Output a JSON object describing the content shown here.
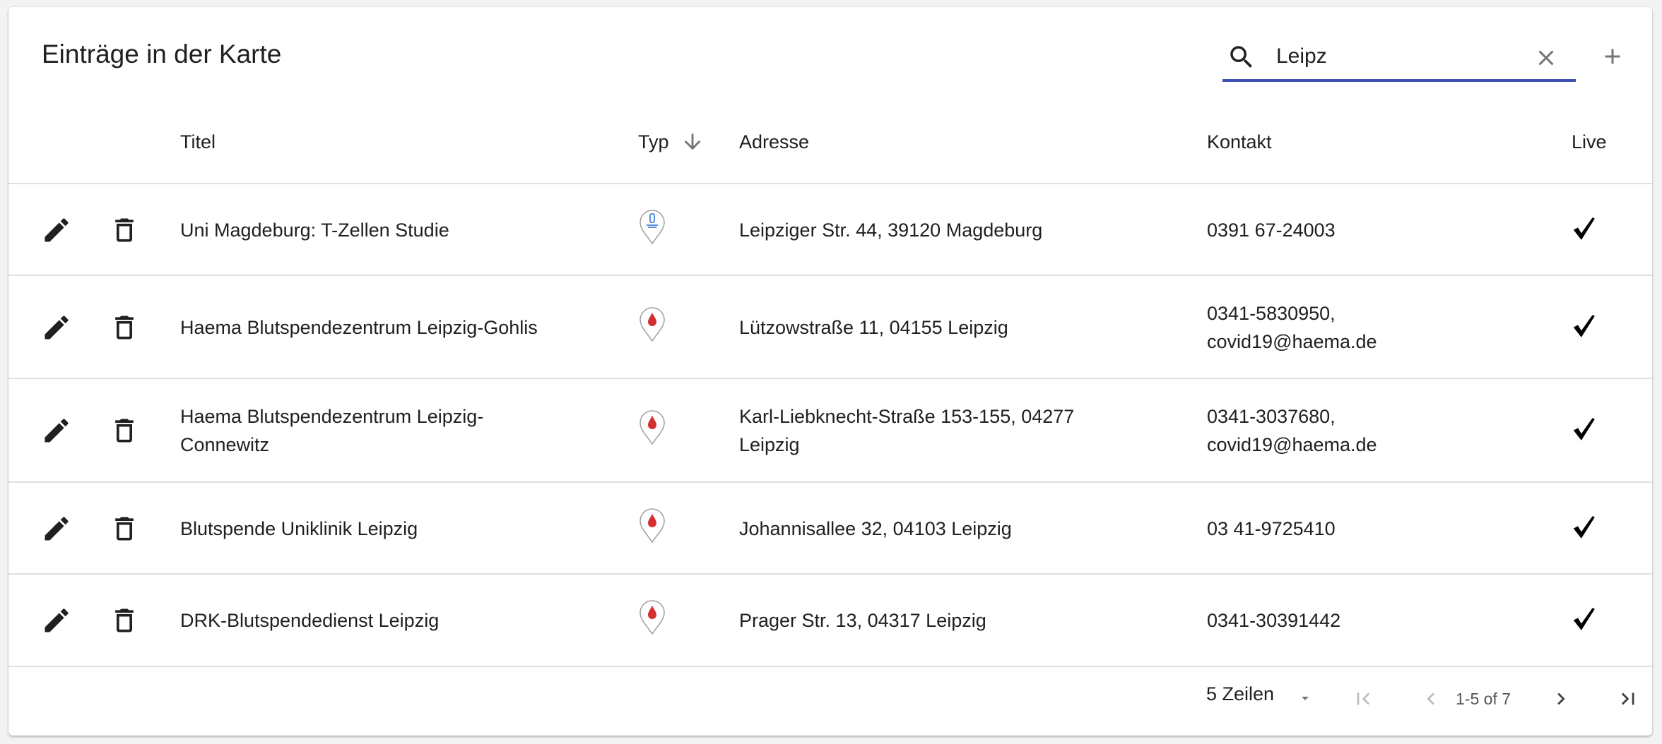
{
  "header": {
    "title": "Einträge in der Karte",
    "search_value": "Leipz"
  },
  "columns": {
    "title": "Titel",
    "type": "Typ",
    "address": "Adresse",
    "contact": "Kontakt",
    "live": "Live"
  },
  "rows": [
    {
      "title": "Uni Magdeburg: T-Zellen Studie",
      "type_icon": "study-marker-icon",
      "address": "Leipziger Str. 44, 39120 Magdeburg",
      "contact": "0391 67-24003",
      "live": true
    },
    {
      "title": "Haema Blutspendezentrum Leipzig-Gohlis",
      "type_icon": "blood-drop-marker-icon",
      "address": "Lützowstraße 11, 04155 Leipzig",
      "contact": "0341-5830950, covid19@haema.de",
      "live": true
    },
    {
      "title": "Haema Blutspendezentrum Leipzig-Connewitz",
      "type_icon": "blood-drop-marker-icon",
      "address": "Karl-Liebknecht-Straße 153-155, 04277 Leipzig",
      "contact": "0341-3037680, covid19@haema.de",
      "live": true
    },
    {
      "title": "Blutspende Uniklinik Leipzig",
      "type_icon": "blood-drop-marker-icon",
      "address": "Johannisallee 32, 04103 Leipzig",
      "contact": "03 41-9725410",
      "live": true
    },
    {
      "title": "DRK-Blutspendedienst Leipzig",
      "type_icon": "blood-drop-marker-icon",
      "address": "Prager Str. 13, 04317 Leipzig",
      "contact": "0341-30391442",
      "live": true
    }
  ],
  "footer": {
    "rows_per_page": "5 Zeilen",
    "range": "1-5 of 7"
  },
  "colors": {
    "accent": "#3f51b5",
    "marker_blood": "#d32f2f",
    "marker_study": "#5b8fd9"
  }
}
